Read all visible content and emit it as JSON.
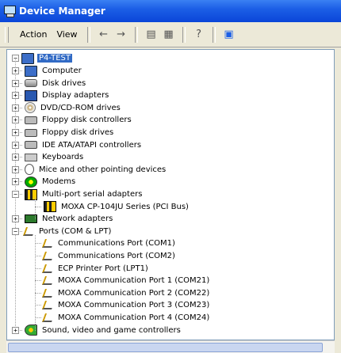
{
  "window": {
    "title": "Device Manager"
  },
  "menubar": {
    "items": [
      "Action",
      "View"
    ],
    "toolbar_icons": [
      "back-arrow-icon",
      "forward-arrow-icon",
      "properties-icon",
      "tree-view-icon",
      "help-icon",
      "scan-hardware-icon"
    ]
  },
  "tree": {
    "root": "P4-TEST",
    "items": [
      {
        "label": "Computer",
        "icon": "computer-icon",
        "level": 1,
        "expand": "+"
      },
      {
        "label": "Disk drives",
        "icon": "disk-icon",
        "level": 1,
        "expand": "+"
      },
      {
        "label": "Display adapters",
        "icon": "monitor-icon",
        "level": 1,
        "expand": "+"
      },
      {
        "label": "DVD/CD-ROM drives",
        "icon": "cdrom-icon",
        "level": 1,
        "expand": "+"
      },
      {
        "label": "Floppy disk controllers",
        "icon": "floppy-controller-icon",
        "level": 1,
        "expand": "+"
      },
      {
        "label": "Floppy disk drives",
        "icon": "floppy-drive-icon",
        "level": 1,
        "expand": "+"
      },
      {
        "label": "IDE ATA/ATAPI controllers",
        "icon": "ide-controller-icon",
        "level": 1,
        "expand": "+"
      },
      {
        "label": "Keyboards",
        "icon": "keyboard-icon",
        "level": 1,
        "expand": "+"
      },
      {
        "label": "Mice and other pointing devices",
        "icon": "mouse-icon",
        "level": 1,
        "expand": "+"
      },
      {
        "label": "Modems",
        "icon": "modem-icon",
        "level": 1,
        "expand": "+"
      },
      {
        "label": "Multi-port serial adapters",
        "icon": "multiport-icon",
        "level": 1,
        "expand": "-"
      },
      {
        "label": "MOXA CP-104JU Series (PCI Bus)",
        "icon": "multiport-icon",
        "level": 2,
        "expand": ""
      },
      {
        "label": "Network adapters",
        "icon": "network-icon",
        "level": 1,
        "expand": "+"
      },
      {
        "label": "Ports (COM & LPT)",
        "icon": "port-icon",
        "level": 1,
        "expand": "-"
      },
      {
        "label": "Communications Port (COM1)",
        "icon": "port-icon",
        "level": 2,
        "expand": ""
      },
      {
        "label": "Communications Port (COM2)",
        "icon": "port-icon",
        "level": 2,
        "expand": ""
      },
      {
        "label": "ECP Printer Port (LPT1)",
        "icon": "port-icon",
        "level": 2,
        "expand": ""
      },
      {
        "label": "MOXA Communication Port 1 (COM21)",
        "icon": "port-icon",
        "level": 2,
        "expand": ""
      },
      {
        "label": "MOXA Communication Port 2 (COM22)",
        "icon": "port-icon",
        "level": 2,
        "expand": ""
      },
      {
        "label": "MOXA Communication Port 3 (COM23)",
        "icon": "port-icon",
        "level": 2,
        "expand": ""
      },
      {
        "label": "MOXA Communication Port 4 (COM24)",
        "icon": "port-icon",
        "level": 2,
        "expand": ""
      },
      {
        "label": "Sound, video and game controllers",
        "icon": "sound-icon",
        "level": 1,
        "expand": "+"
      }
    ]
  },
  "colors": {
    "titlebar": "#0a45d8",
    "selection": "#316ac5"
  }
}
